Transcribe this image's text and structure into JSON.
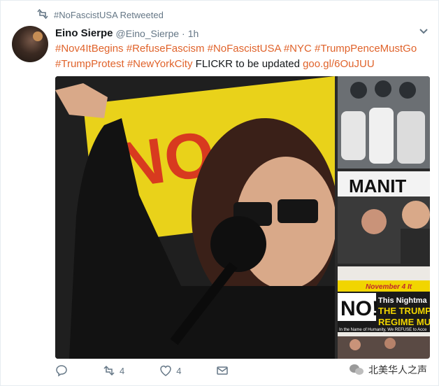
{
  "retweet": {
    "icon": "retweet-icon",
    "text": "#NoFascistUSA Retweeted"
  },
  "author": {
    "name": "Eino Sierpe",
    "handle": "@Eino_Sierpe",
    "separator": "·",
    "time": "1h"
  },
  "tweet_text": {
    "tags": [
      "#Nov4ItBegins",
      "#RefuseFascism",
      "#NoFascistUSA",
      "#NYC",
      "#TrumpPenceMustGo",
      "#TrumpProtest",
      "#NewYorkCity"
    ],
    "body": "FLICKR to be updated",
    "link": "goo.gl/6OuJUU"
  },
  "media": {
    "banner_text": "NO",
    "photo2_banner": "MANIT",
    "photo3": {
      "date_text": "November 4 It",
      "no_text": "NO!",
      "line1": "This Nightma",
      "line2": "THE TRUMP",
      "line3": "REGIME MU",
      "bottom": "In the Name of Humanity, We REFUSE to Acce"
    }
  },
  "actions": {
    "reply_icon": "reply-icon",
    "retweet_count": "4",
    "like_count": "4",
    "dm_icon": "envelope-icon"
  },
  "watermark": {
    "text": "北美华人之声"
  },
  "colors": {
    "accent": "#e0632b",
    "muted": "#657786"
  }
}
